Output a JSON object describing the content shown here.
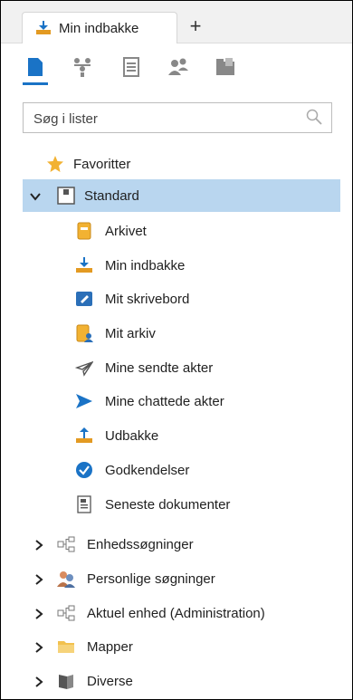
{
  "tab": {
    "label": "Min indbakke",
    "add_label": "+"
  },
  "search": {
    "placeholder": "Søg i lister"
  },
  "tree": {
    "favorites": "Favoritter",
    "standard": "Standard",
    "children": [
      "Arkivet",
      "Min indbakke",
      "Mit skrivebord",
      "Mit arkiv",
      "Mine sendte akter",
      "Mine chattede akter",
      "Udbakke",
      "Godkendelser",
      "Seneste dokumenter"
    ],
    "groups": [
      "Enhedssøgninger",
      "Personlige søgninger",
      "Aktuel enhed (Administration)",
      "Mapper",
      "Diverse"
    ]
  },
  "colors": {
    "accent": "#1a73c6",
    "selected_bg": "#b9d6ef",
    "star": "#f2b232",
    "tray": "#e39a22"
  }
}
